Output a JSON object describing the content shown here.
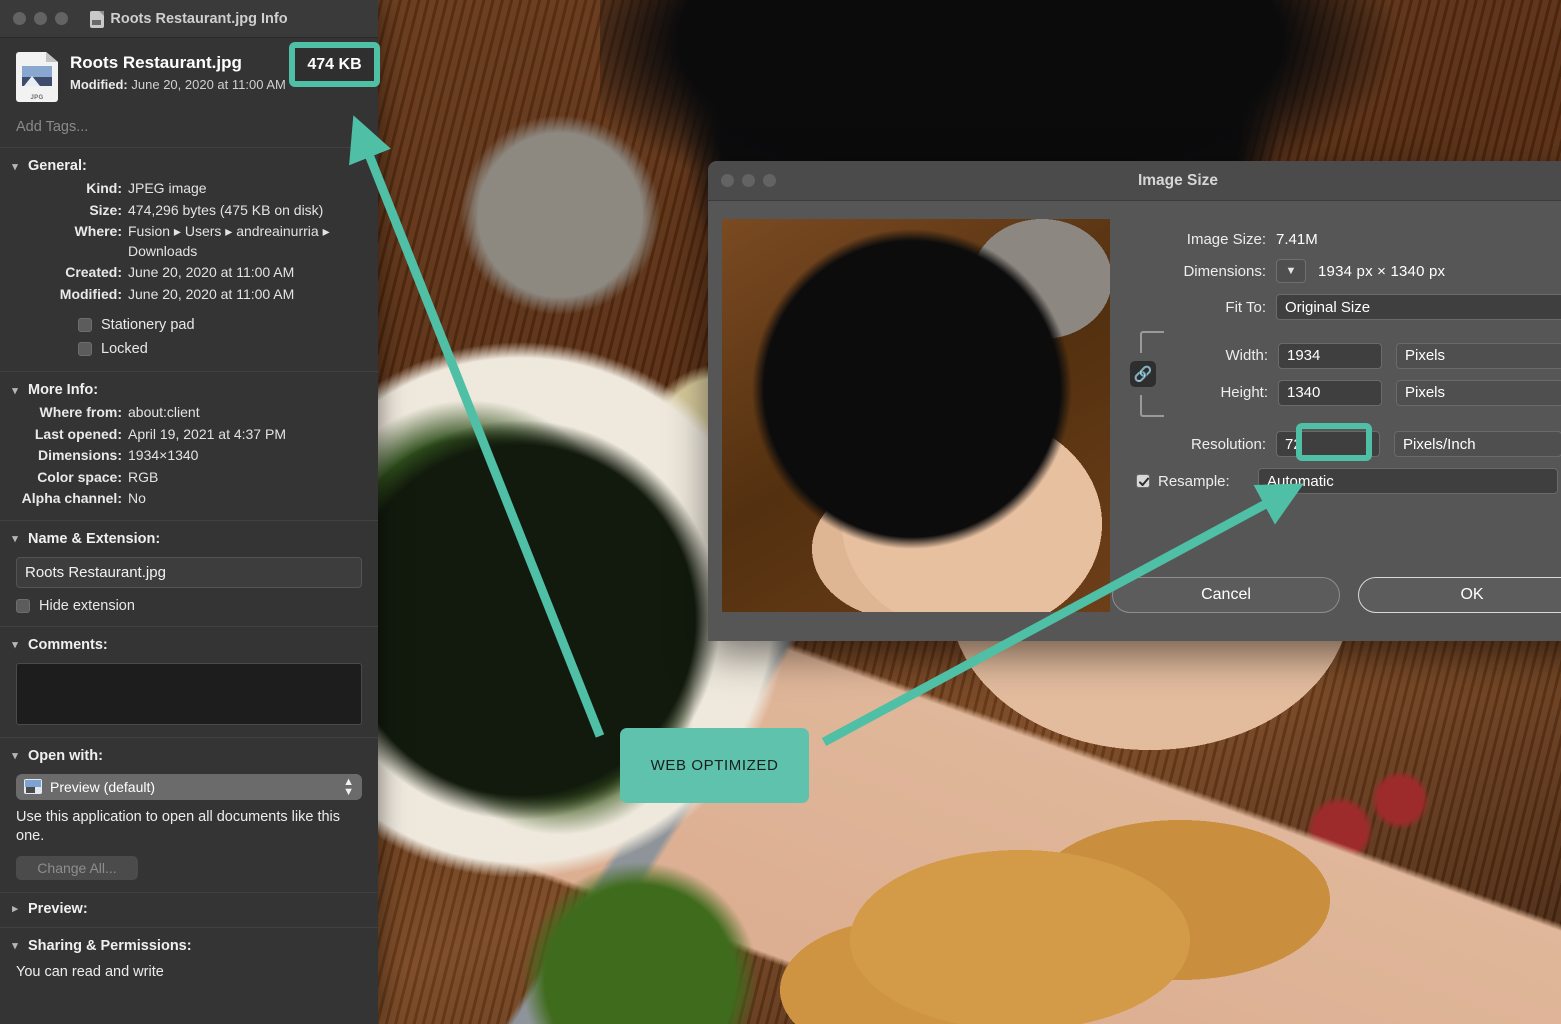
{
  "info_window": {
    "title": "Roots Restaurant.jpg Info",
    "title_icon": "document-icon",
    "file_name": "Roots Restaurant.jpg",
    "file_icon_ext": "JPG",
    "modified_label": "Modified:",
    "modified_value": "June 20, 2020 at 11:00 AM",
    "size_badge": "474 KB",
    "add_tags_placeholder": "Add Tags...",
    "general": {
      "heading": "General:",
      "rows": [
        {
          "key": "Kind:",
          "value": "JPEG image"
        },
        {
          "key": "Size:",
          "value": "474,296 bytes (475 KB on disk)"
        },
        {
          "key": "Where:",
          "value": "Fusion ▸ Users ▸ andreainurria ▸ Downloads"
        },
        {
          "key": "Created:",
          "value": "June 20, 2020 at 11:00 AM"
        },
        {
          "key": "Modified:",
          "value": "June 20, 2020 at 11:00 AM"
        }
      ],
      "stationery_pad": "Stationery pad",
      "locked": "Locked"
    },
    "more_info": {
      "heading": "More Info:",
      "rows": [
        {
          "key": "Where from:",
          "value": "about:client"
        },
        {
          "key": "Last opened:",
          "value": "April 19, 2021 at 4:37 PM"
        },
        {
          "key": "Dimensions:",
          "value": "1934×1340"
        },
        {
          "key": "Color space:",
          "value": "RGB"
        },
        {
          "key": "Alpha channel:",
          "value": "No"
        }
      ]
    },
    "name_extension": {
      "heading": "Name & Extension:",
      "value": "Roots Restaurant.jpg",
      "hide_extension": "Hide extension"
    },
    "comments": {
      "heading": "Comments:",
      "value": ""
    },
    "open_with": {
      "heading": "Open with:",
      "selected": "Preview (default)",
      "note": "Use this application to open all documents like this one.",
      "change_all": "Change All..."
    },
    "preview": {
      "heading": "Preview:"
    },
    "sharing": {
      "heading": "Sharing & Permissions:",
      "note": "You can read and write"
    }
  },
  "dialog": {
    "title": "Image Size",
    "image_size_label": "Image Size:",
    "image_size_value": "7.41M",
    "dimensions_label": "Dimensions:",
    "dimensions_value": "1934 px  ×  1340 px",
    "fit_to_label": "Fit To:",
    "fit_to_value": "Original Size",
    "width_label": "Width:",
    "width_value": "1934",
    "width_unit": "Pixels",
    "height_label": "Height:",
    "height_value": "1340",
    "height_unit": "Pixels",
    "resolution_label": "Resolution:",
    "resolution_value": "72",
    "resolution_unit": "Pixels/Inch",
    "resample_label": "Resample:",
    "resample_value": "Automatic",
    "cancel": "Cancel",
    "ok": "OK"
  },
  "annotations": {
    "label": "WEB OPTIMIZED",
    "accent_color": "#5fc2ac",
    "highlight_border": "#4fbfa5"
  }
}
